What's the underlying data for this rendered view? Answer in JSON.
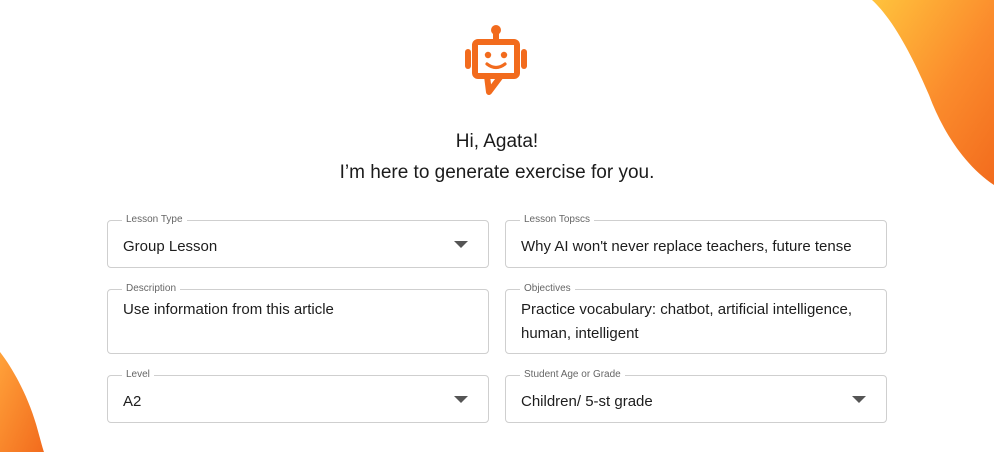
{
  "greeting": {
    "line1": "Hi, Agata!",
    "line2": "I’m here to generate exercise for you."
  },
  "form": {
    "lesson_type": {
      "label": "Lesson Type",
      "value": "Group Lesson"
    },
    "lesson_topics": {
      "label": "Lesson Topscs",
      "value": "Why AI won't never replace teachers, future tense"
    },
    "description": {
      "label": "Description",
      "value": "Use information from this article"
    },
    "objectives": {
      "label": "Objectives",
      "value": "Practice vocabulary: chatbot, artificial intelligence, human, intelligent"
    },
    "level": {
      "label": "Level",
      "value": "A2"
    },
    "student_age": {
      "label": "Student Age or Grade",
      "value": "Children/ 5-st grade"
    }
  },
  "icons": {
    "logo": "robot-chat-icon",
    "dropdown": "caret-down-icon"
  },
  "colors": {
    "brand_orange": "#F26B1D",
    "blob_yellow": "#FFC33D"
  }
}
